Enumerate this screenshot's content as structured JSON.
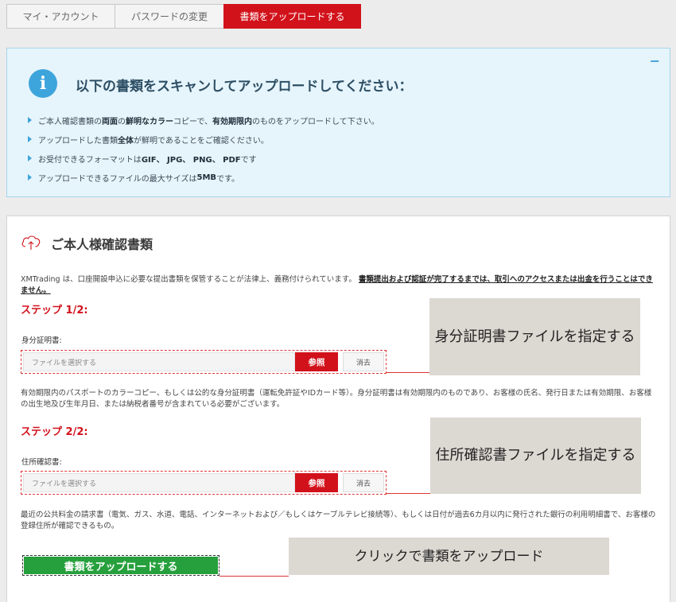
{
  "tabs": [
    {
      "label": "マイ・アカウント"
    },
    {
      "label": "パスワードの変更"
    },
    {
      "label": "書類をアップロードする"
    }
  ],
  "info": {
    "collapse": "−",
    "icon": "info-icon",
    "title": "以下の書類をスキャンしてアップロードしてください：",
    "bullets": [
      {
        "pre": "ご本人確認書類の ",
        "b1": "両面",
        "mid": " の ",
        "b2": "鮮明なカラー",
        "mid2": " コピーで、 ",
        "b3": "有効期限内",
        "post": " のものをアップロードして下さい。"
      },
      {
        "pre": "アップロードした書類",
        "b1": "全体",
        "post": "が鮮明であることをご確認ください。"
      },
      {
        "pre": "お受付できるフォーマットは ",
        "b1": "GIF、 JPG、 PNG、 PDF",
        "post": "です"
      },
      {
        "pre": "アップロードできるファイルの最大サイズは",
        "b1": "5MB",
        "post": "です。"
      }
    ]
  },
  "card": {
    "icon": "cloud-upload-icon",
    "heading": "ご本人様確認書類",
    "legal_text": "XMTrading は、口座開設申込に必要な提出書類を保管することが法律上、義務付けられています。",
    "legal_bold": "書類提出および認証が完了するまでは、取引へのアクセスまたは出金を行うことはできません。",
    "step1": {
      "title": "ステップ 1/2:",
      "label": "身分証明書:",
      "placeholder": "ファイルを選択する",
      "browse": "参照",
      "clear": "消去",
      "desc": "有効期限内のパスポートのカラーコピー、もしくは公的な身分証明書（運転免許証やIDカード等）。身分証明書は有効期限内のものであり、お客様の氏名、発行日または有効期限、お客様の出生地及び生年月日、または納税者番号が含まれている必要がございます。",
      "callout": "身分証明書ファイルを指定する"
    },
    "step2": {
      "title": "ステップ 2/2:",
      "label": "住所確認書:",
      "placeholder": "ファイルを選択する",
      "browse": "参照",
      "clear": "消去",
      "desc": "最近の公共料金の請求書（電気、ガス、水道、電話、インターネットおよび／もしくはケーブルテレビ接続等）、もしくは日付が過去6カ月以内に発行された銀行の利用明細書で、お客様の登録住所が確認できるもの。",
      "callout": "住所確認書ファイルを指定する"
    },
    "upload_button": "書類をアップロードする",
    "upload_callout": "クリックで書類をアップロード"
  }
}
